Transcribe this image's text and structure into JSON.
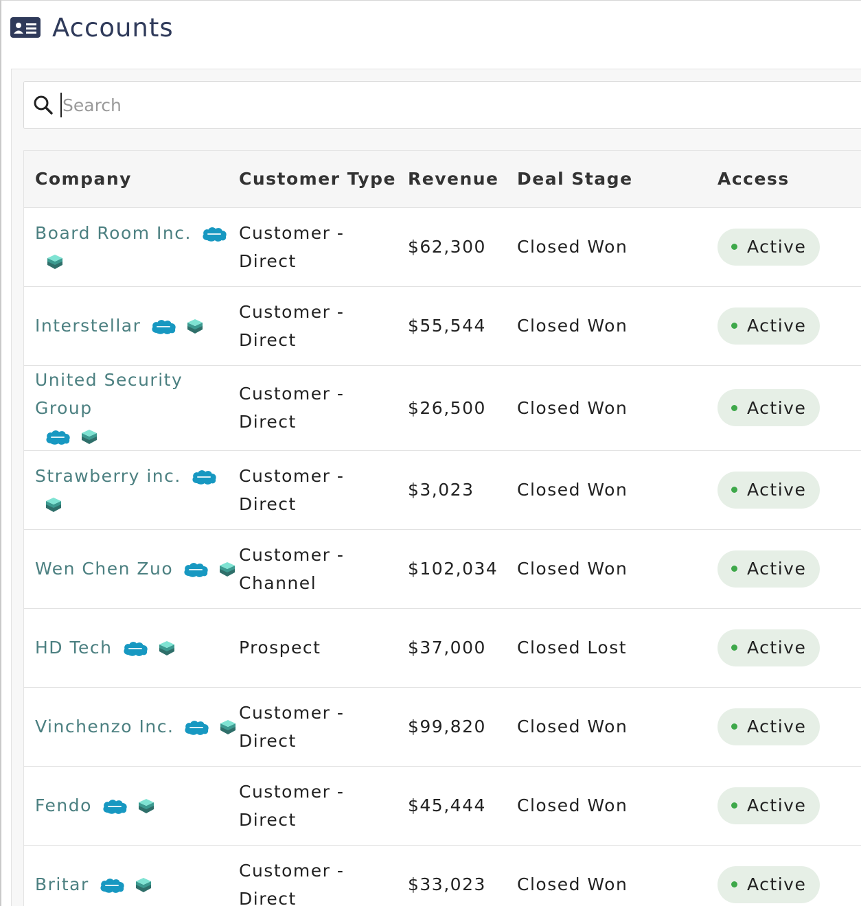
{
  "page": {
    "title": "Accounts"
  },
  "search": {
    "placeholder": "Search",
    "value": ""
  },
  "table": {
    "headers": {
      "company": "Company",
      "customer_type": "Customer Type",
      "revenue": "Revenue",
      "deal_stage": "Deal Stage",
      "access": "Access"
    },
    "rows": [
      {
        "company": "Board Room Inc.",
        "customer_type_line1": "Customer -",
        "customer_type_line2": "Direct",
        "revenue": "$62,300",
        "deal_stage": "Closed Won",
        "access": "Active"
      },
      {
        "company": "Interstellar",
        "customer_type_line1": "Customer -",
        "customer_type_line2": "Direct",
        "revenue": "$55,544",
        "deal_stage": "Closed Won",
        "access": "Active"
      },
      {
        "company": "United Security Group",
        "customer_type_line1": "Customer -",
        "customer_type_line2": "Direct",
        "revenue": "$26,500",
        "deal_stage": "Closed Won",
        "access": "Active"
      },
      {
        "company": "Strawberry inc.",
        "customer_type_line1": "Customer -",
        "customer_type_line2": "Direct",
        "revenue": "$3,023",
        "deal_stage": "Closed Won",
        "access": "Active"
      },
      {
        "company": "Wen Chen Zuo",
        "customer_type_line1": "Customer -",
        "customer_type_line2": "Channel",
        "revenue": "$102,034",
        "deal_stage": "Closed Won",
        "access": "Active"
      },
      {
        "company": "HD Tech",
        "customer_type_line1": "Prospect",
        "customer_type_line2": "",
        "revenue": "$37,000",
        "deal_stage": "Closed Lost",
        "access": "Active"
      },
      {
        "company": "Vinchenzo Inc.",
        "customer_type_line1": "Customer -",
        "customer_type_line2": "Direct",
        "revenue": "$99,820",
        "deal_stage": "Closed Won",
        "access": "Active"
      },
      {
        "company": "Fendo",
        "customer_type_line1": "Customer -",
        "customer_type_line2": "Direct",
        "revenue": "$45,444",
        "deal_stage": "Closed Won",
        "access": "Active"
      },
      {
        "company": "Britar",
        "customer_type_line1": "Customer -",
        "customer_type_line2": "Direct",
        "revenue": "$33,023",
        "deal_stage": "Closed Won",
        "access": "Active"
      }
    ]
  },
  "icons": {
    "page": "id-card-icon",
    "search": "search-icon",
    "salesforce": "salesforce-cloud-icon",
    "stack": "layers-stack-icon"
  },
  "colors": {
    "title": "#2f3a5a",
    "company_link": "#4c8081",
    "status_pill_bg": "#e6efe6",
    "status_dot": "#3ea84a",
    "salesforce_blue": "#1798c1"
  }
}
